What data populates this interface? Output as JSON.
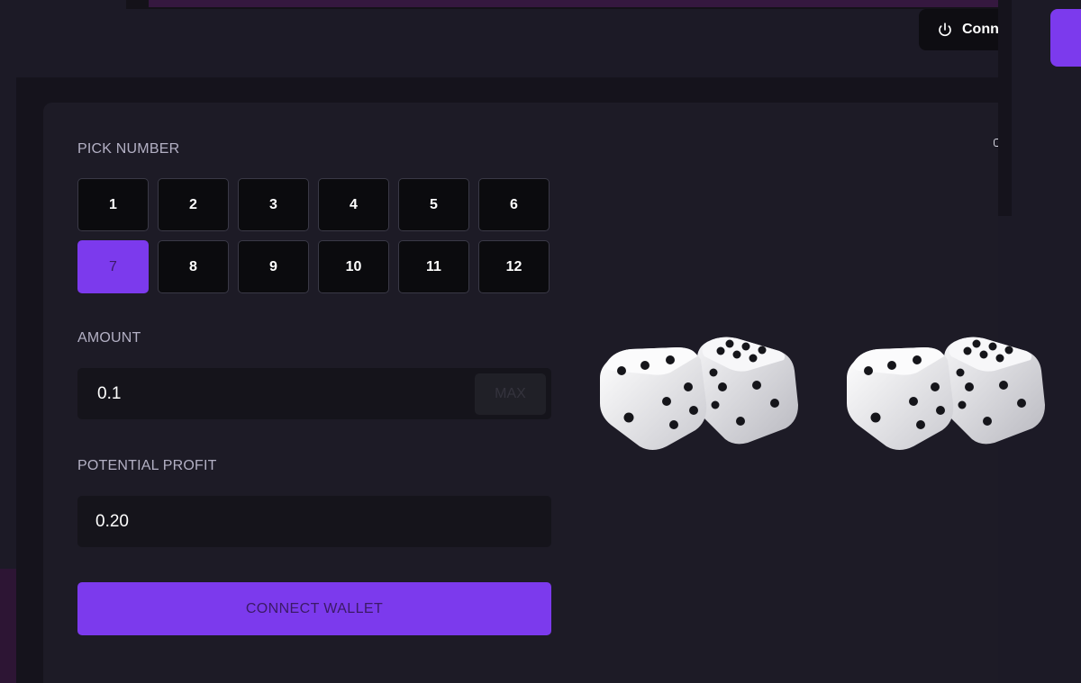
{
  "header": {
    "connect_label": "Conn"
  },
  "game": {
    "pick_number_label": "PICK NUMBER",
    "numbers": [
      "1",
      "2",
      "3",
      "4",
      "5",
      "6",
      "7",
      "8",
      "9",
      "10",
      "11",
      "12"
    ],
    "selected_number": "7",
    "amount_label": "AMOUNT",
    "amount_value": "0.1",
    "max_label": "MAX",
    "profit_label": "POTENTIAL PROFIT",
    "profit_value": "0.20",
    "connect_wallet_label": "CONNECT WALLET"
  },
  "colors": {
    "accent": "#7c3aed",
    "background": "#1c1a26",
    "card": "#1d1b26"
  },
  "icons": {
    "connect": "power-icon",
    "dice": "dice-pair-icon"
  }
}
